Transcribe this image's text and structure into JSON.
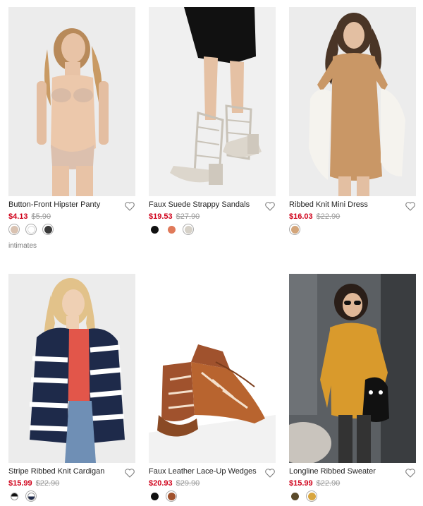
{
  "products": [
    {
      "name": "Button-Front Hipster Panty",
      "sale_price": "$4.13",
      "orig_price": "$5.90",
      "swatches": [
        "#d9c2b1",
        "#ffffff",
        "#3a3a3a"
      ]
    },
    {
      "name": "Faux Suede Strappy Sandals",
      "sale_price": "$19.53",
      "orig_price": "$27.90",
      "swatches": [
        "#111111",
        "#e07a5a",
        "#d6d1c8"
      ]
    },
    {
      "name": "Ribbed Knit Mini Dress",
      "sale_price": "$16.03",
      "orig_price": "$22.90",
      "swatches": [
        "#d3a57a"
      ]
    },
    {
      "name": "Stripe Ribbed Knit Cardigan",
      "sale_price": "$15.99",
      "orig_price": "$22.90",
      "swatches": [
        "#111111/#ffffff",
        "#1e2a4a/#ffffff"
      ]
    },
    {
      "name": "Faux Leather Lace-Up Wedges",
      "sale_price": "$20.93",
      "orig_price": "$29.90",
      "swatches": [
        "#111111",
        "#a0522d"
      ]
    },
    {
      "name": "Longline Ribbed Sweater",
      "sale_price": "$15.99",
      "orig_price": "$22.90",
      "swatches": [
        "#5a4a2a",
        "#d8a640"
      ]
    }
  ],
  "category_tag": "intimates",
  "colors": {
    "sale": "#d0021b",
    "strike": "#999999",
    "photo_bg": "#ececec"
  }
}
